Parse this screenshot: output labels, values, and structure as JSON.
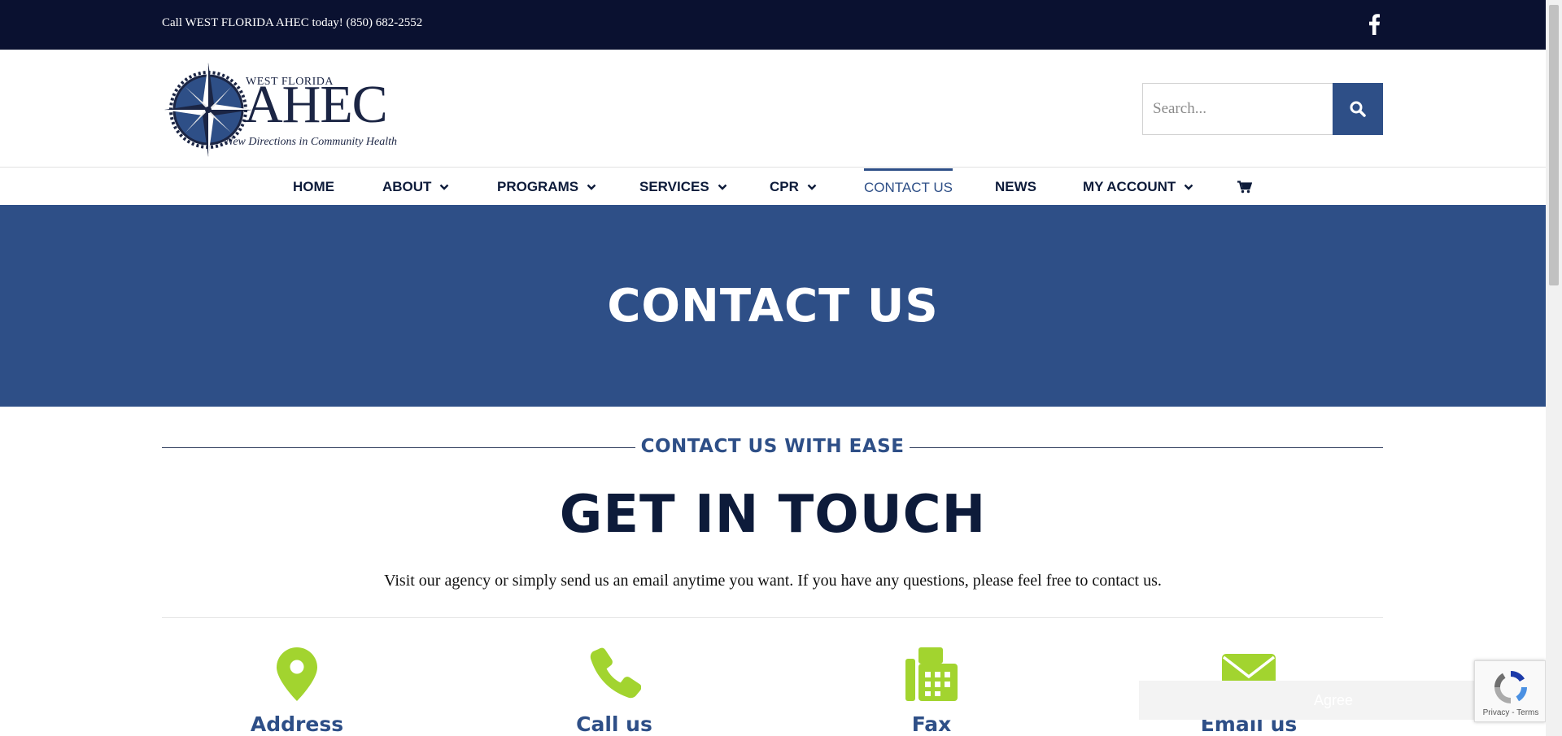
{
  "topbar": {
    "phone_text": "Call WEST FLORIDA AHEC today! (850) 682-2552",
    "social_icon": "facebook-icon"
  },
  "logo": {
    "line1": "WEST FLORIDA",
    "line2": "AHEC",
    "tagline": "New Directions in Community Health"
  },
  "search": {
    "placeholder": "Search...",
    "icon": "search-icon"
  },
  "nav": {
    "items": [
      {
        "label": "HOME",
        "has_dropdown": false
      },
      {
        "label": "ABOUT",
        "has_dropdown": true
      },
      {
        "label": "PROGRAMS",
        "has_dropdown": true
      },
      {
        "label": "SERVICES",
        "has_dropdown": true
      },
      {
        "label": "CPR",
        "has_dropdown": true
      },
      {
        "label": "CONTACT US",
        "has_dropdown": false,
        "active": true
      },
      {
        "label": "NEWS",
        "has_dropdown": false
      },
      {
        "label": "MY ACCOUNT",
        "has_dropdown": true
      }
    ],
    "cart_icon": "cart-icon"
  },
  "hero": {
    "title": "CONTACT US"
  },
  "content": {
    "eyebrow": "CONTACT US WITH EASE",
    "title": "GET IN TOUCH",
    "intro": "Visit our agency or simply send us an email anytime you want. If you have any questions, please feel free to contact us.",
    "cards": [
      {
        "label": "Address",
        "icon": "map-pin-icon"
      },
      {
        "label": "Call us",
        "icon": "phone-icon"
      },
      {
        "label": "Fax",
        "icon": "fax-icon"
      },
      {
        "label": "Email us",
        "icon": "envelope-icon"
      }
    ]
  },
  "cookie": {
    "agree_label": "Agree"
  },
  "recaptcha": {
    "links": "Privacy - Terms"
  },
  "colors": {
    "topbar": "#0a1130",
    "primary": "#2e4f87",
    "heading": "#0d1b3a",
    "accent_green": "#a2d42f"
  }
}
